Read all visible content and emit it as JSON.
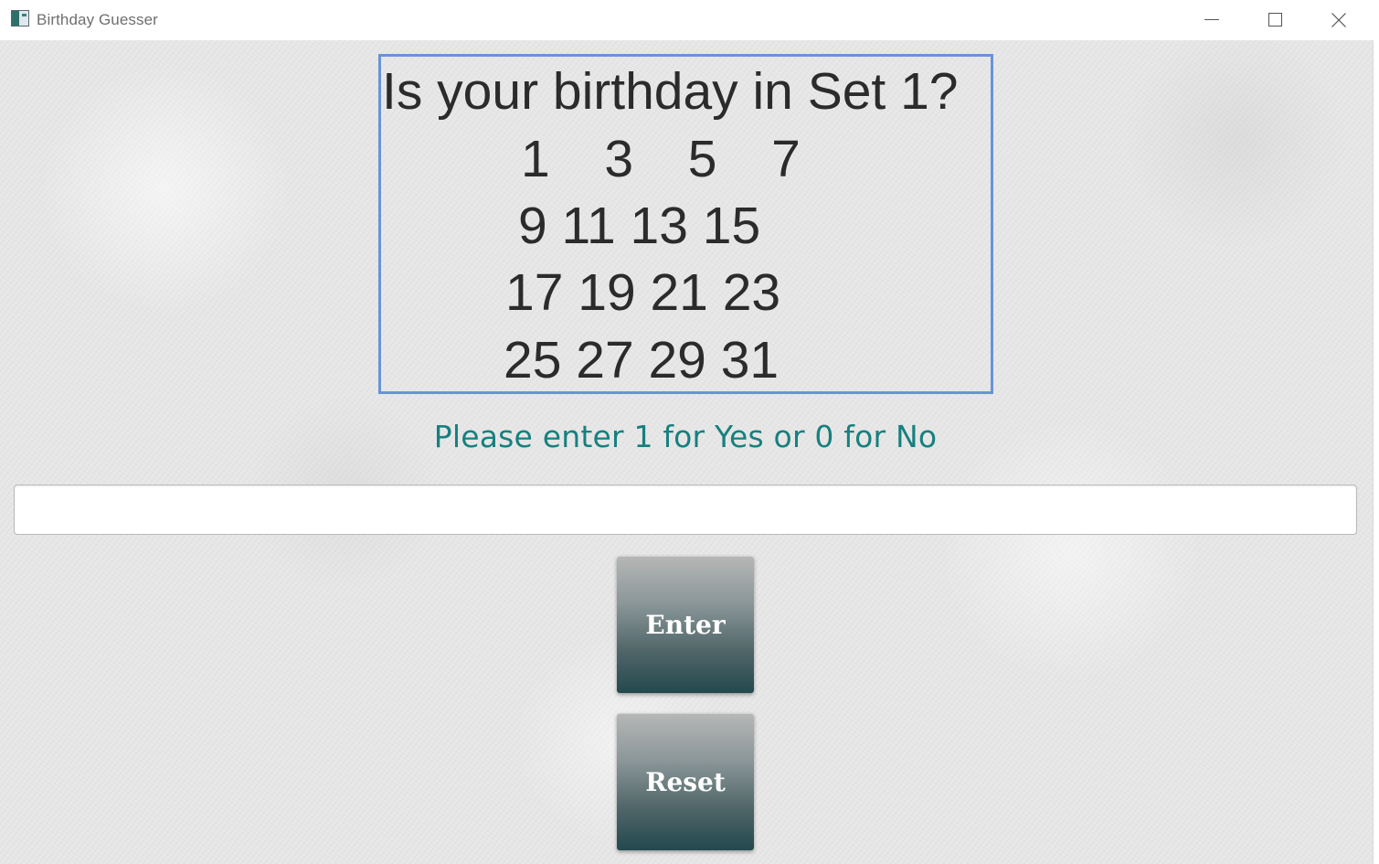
{
  "window": {
    "title": "Birthday Guesser",
    "icon": "app-window-icon"
  },
  "question": {
    "text": "Is your birthday in Set 1?",
    "rows": [
      "1  3  5  7",
      "9 11 13 15",
      "17 19 21 23",
      "25 27 29 31"
    ]
  },
  "prompt": "Please enter 1 for Yes or 0 for No",
  "answer": {
    "value": "",
    "placeholder": ""
  },
  "buttons": {
    "enter": "Enter",
    "reset": "Reset"
  },
  "colors": {
    "prompt_text": "#17807f",
    "box_border": "#6b93d6",
    "button_top": "#b7b7b7",
    "button_bottom": "#23494e"
  }
}
